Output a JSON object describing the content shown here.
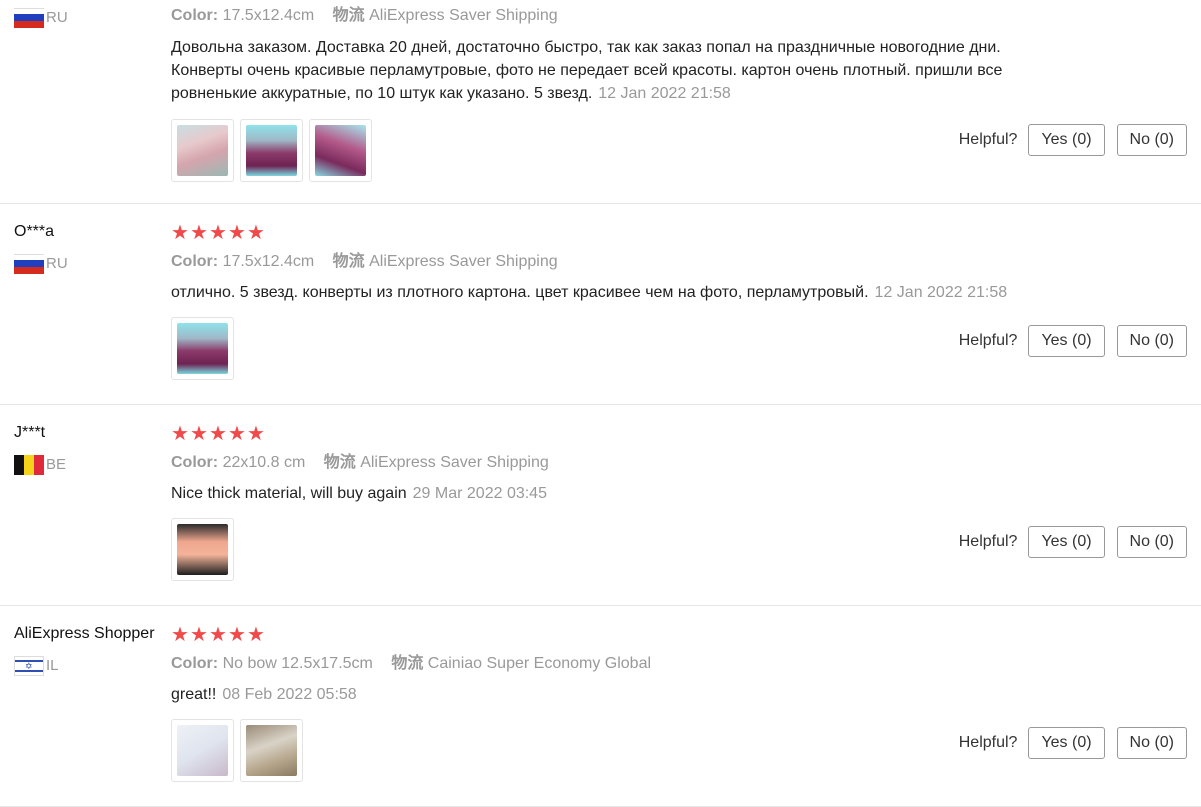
{
  "helpful_label": "Helpful?",
  "colors": {
    "star": "#f04a4a",
    "muted": "#999999",
    "border": "#e6e6e6"
  },
  "reviews": [
    {
      "username": "",
      "country": "RU",
      "flag": "flag-ru",
      "rating": 5,
      "stars_visible": false,
      "color_label": "Color:",
      "color_value": "17.5x12.4cm",
      "shipping_label": "物流",
      "shipping_value": "AliExpress Saver Shipping",
      "text": "Довольна заказом. Доставка 20 дней, достаточно быстро, так как заказ попал на праздничные новогодние дни. Конверты очень красивые перламутровые, фото не передает всей красоты. картон очень плотный. пришли все ровненькие аккуратные, по 10 штук как указано. 5 звезд.",
      "date": "12 Jan 2022 21:58",
      "photos": [
        "img-pink",
        "img-box",
        "img-box2"
      ],
      "yes_label": "Yes (0)",
      "no_label": "No (0)"
    },
    {
      "username": "O***a",
      "country": "RU",
      "flag": "flag-ru",
      "rating": 5,
      "stars_visible": true,
      "color_label": "Color:",
      "color_value": "17.5x12.4cm",
      "shipping_label": "物流",
      "shipping_value": "AliExpress Saver Shipping",
      "text": "отлично. 5 звезд. конверты из плотного картона. цвет красивее чем на фото, перламутровый.",
      "date": "12 Jan 2022 21:58",
      "photos": [
        "img-box"
      ],
      "yes_label": "Yes (0)",
      "no_label": "No (0)"
    },
    {
      "username": "J***t",
      "country": "BE",
      "flag": "flag-be",
      "rating": 5,
      "stars_visible": true,
      "color_label": "Color:",
      "color_value": "22x10.8 cm",
      "shipping_label": "物流",
      "shipping_value": "AliExpress Saver Shipping",
      "text": "Nice thick material, will buy again",
      "date": "29 Mar 2022 03:45",
      "photos": [
        "img-dark"
      ],
      "yes_label": "Yes (0)",
      "no_label": "No (0)"
    },
    {
      "username": "AliExpress Shopper",
      "country": "IL",
      "flag": "flag-il",
      "rating": 5,
      "stars_visible": true,
      "color_label": "Color:",
      "color_value": "No bow 12.5x17.5cm",
      "shipping_label": "物流",
      "shipping_value": "Cainiao Super Economy Global",
      "text": "great!!",
      "date": "08 Feb 2022 05:58",
      "photos": [
        "img-paper",
        "img-brown"
      ],
      "yes_label": "Yes (0)",
      "no_label": "No (0)"
    }
  ]
}
